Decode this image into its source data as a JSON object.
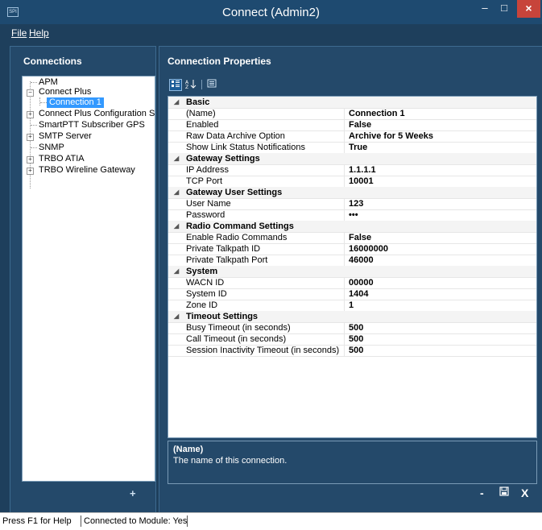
{
  "window": {
    "title": "Connect (Admin2)",
    "icon_text": "SPI",
    "controls": {
      "minimize": "–",
      "maximize": "□",
      "close": "×"
    }
  },
  "menu": {
    "file": "File",
    "help": "Help"
  },
  "connections_panel": {
    "title": "Connections",
    "tree": [
      {
        "label": "APM",
        "level": 0,
        "expander": "none"
      },
      {
        "label": "Connect Plus",
        "level": 0,
        "expander": "minus"
      },
      {
        "label": "Connection 1",
        "level": 1,
        "expander": "none",
        "selected": true
      },
      {
        "label": "Connect Plus Configuration Se",
        "level": 0,
        "expander": "plus"
      },
      {
        "label": "SmartPTT Subscriber GPS",
        "level": 0,
        "expander": "none"
      },
      {
        "label": "SMTP Server",
        "level": 0,
        "expander": "plus"
      },
      {
        "label": "SNMP",
        "level": 0,
        "expander": "none"
      },
      {
        "label": "TRBO ATIA",
        "level": 0,
        "expander": "plus"
      },
      {
        "label": "TRBO Wireline Gateway",
        "level": 0,
        "expander": "plus"
      }
    ],
    "add_button": "+"
  },
  "properties_panel": {
    "title": "Connection Properties",
    "toolbar_icons": [
      "categorized-icon",
      "sort-alpha-icon",
      "property-pages-icon"
    ],
    "categories": [
      {
        "name": "Basic",
        "rows": [
          {
            "name": "(Name)",
            "value": "Connection 1"
          },
          {
            "name": "Enabled",
            "value": "False"
          },
          {
            "name": "Raw Data Archive Option",
            "value": "Archive for 5 Weeks"
          },
          {
            "name": "Show Link Status Notifications",
            "value": "True"
          }
        ]
      },
      {
        "name": "Gateway Settings",
        "rows": [
          {
            "name": "IP Address",
            "value": "1.1.1.1"
          },
          {
            "name": "TCP Port",
            "value": "10001"
          }
        ]
      },
      {
        "name": "Gateway User Settings",
        "rows": [
          {
            "name": "User Name",
            "value": "123"
          },
          {
            "name": "Password",
            "value": "•••"
          }
        ]
      },
      {
        "name": "Radio Command Settings",
        "rows": [
          {
            "name": "Enable Radio Commands",
            "value": "False"
          },
          {
            "name": "Private Talkpath ID",
            "value": "16000000"
          },
          {
            "name": "Private Talkpath Port",
            "value": "46000"
          }
        ]
      },
      {
        "name": "System",
        "rows": [
          {
            "name": "WACN ID",
            "value": "00000"
          },
          {
            "name": "System ID",
            "value": "1404"
          },
          {
            "name": "Zone ID",
            "value": "1"
          }
        ]
      },
      {
        "name": "Timeout Settings",
        "rows": [
          {
            "name": "Busy Timeout (in seconds)",
            "value": "500"
          },
          {
            "name": "Call Timeout (in seconds)",
            "value": "500"
          },
          {
            "name": "Session Inactivity Timeout (in seconds)",
            "value": "500"
          }
        ]
      }
    ],
    "description": {
      "title": "(Name)",
      "text": "The name of this connection."
    },
    "actions": {
      "minimize": "-",
      "save": "💾",
      "close": "X"
    }
  },
  "statusbar": {
    "help": "Press F1 for Help",
    "module": "Connected to Module: Yes"
  }
}
